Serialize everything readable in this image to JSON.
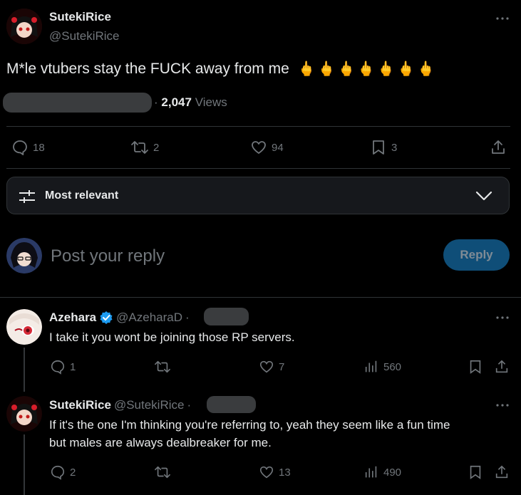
{
  "main_post": {
    "display_name": "SutekiRice",
    "handle": "@SutekiRice",
    "text": "M*le vtubers stay the FUCK away from me",
    "emoji": "🖕🖕🖕🖕🖕🖕🖕",
    "views_count": "2,047",
    "views_label": "Views",
    "replies": "18",
    "reposts": "2",
    "likes": "94",
    "bookmarks": "3"
  },
  "sort": {
    "label": "Most relevant"
  },
  "composer": {
    "placeholder": "Post your reply",
    "reply_button": "Reply"
  },
  "replies": [
    {
      "display_name": "Azehara",
      "handle": "@AzeharaD",
      "text": "I take it you wont be joining those RP servers.",
      "replies": "1",
      "reposts": "",
      "likes": "7",
      "views": "560"
    },
    {
      "display_name": "SutekiRice",
      "handle": "@SutekiRice",
      "text_line1": "If it's the one I'm thinking you're referring to, yeah they seem like a fun time",
      "text_line2": "but males are always dealbreaker for me.",
      "replies": "2",
      "reposts": "",
      "likes": "13",
      "views": "490"
    }
  ],
  "colors": {
    "accent": "#1d9bf0",
    "verified": "#1d9bf0",
    "border": "#2f3336",
    "muted": "#71767b"
  }
}
